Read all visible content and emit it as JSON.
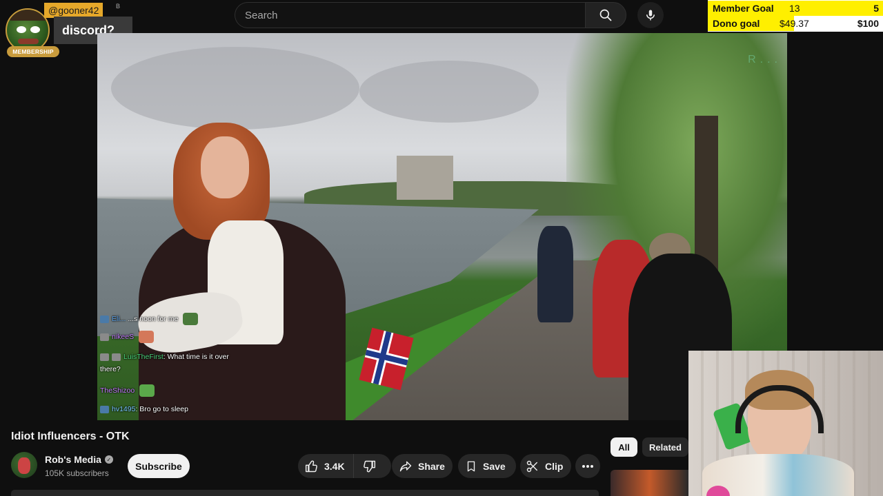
{
  "search": {
    "placeholder": "Search"
  },
  "overlay": {
    "username": "@gooner42",
    "username_suffix": "B",
    "message": "discord?",
    "badge": "MEMBERSHIP"
  },
  "goals": {
    "member": {
      "label": "Member Goal",
      "current": "13",
      "target": "5"
    },
    "dono": {
      "label": "Dono goal",
      "current": "$49.37",
      "target": "$100",
      "progress": 0.4937
    }
  },
  "video": {
    "watermark": "R..."
  },
  "chat": [
    {
      "user": "Eli...",
      "text": "...s noon for me",
      "color": "u-blue"
    },
    {
      "user": "nikeeS",
      "text": "",
      "color": "u-purple"
    },
    {
      "user": "LuisTheFirst",
      "text": ": What time is it over",
      "cont": "there?",
      "color": "u-green"
    },
    {
      "user": "TheShizoo",
      "text": "",
      "color": "u-purple"
    },
    {
      "user": "hv1495",
      "text": ": Bro go to sleep",
      "color": "u-teal"
    }
  ],
  "video_info": {
    "title": "Idiot Influencers - OTK",
    "channel": "Rob's Media",
    "subscribers": "105K subscribers",
    "subscribe_label": "Subscribe",
    "likes": "3.4K",
    "share_label": "Share",
    "save_label": "Save",
    "clip_label": "Clip"
  },
  "chips": {
    "all": "All",
    "related": "Related"
  },
  "colors": {
    "goal_yellow": "#ffef00",
    "membership_gold": "#c89b3c",
    "bg": "#0f0f0f",
    "pill": "#272727"
  }
}
